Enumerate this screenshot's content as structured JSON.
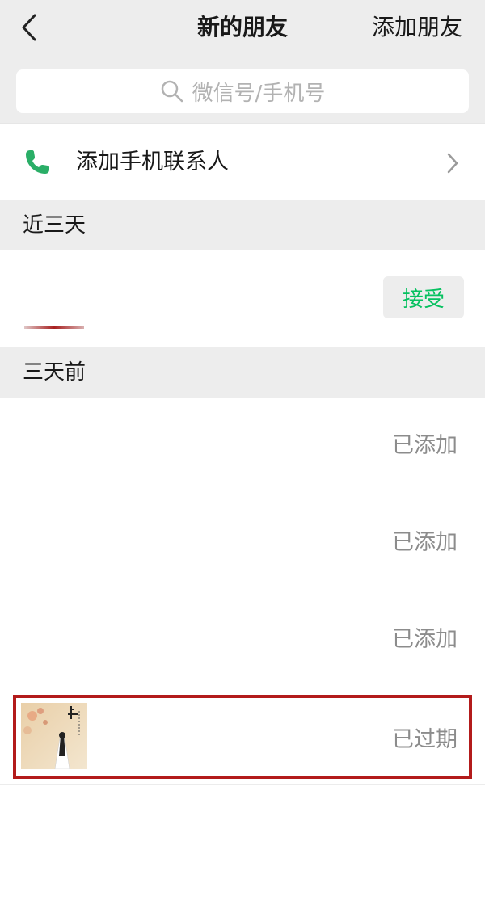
{
  "header": {
    "title": "新的朋友",
    "add_friend_label": "添加朋友",
    "search_placeholder": "微信号/手机号"
  },
  "phone_contacts": {
    "label": "添加手机联系人"
  },
  "sections": {
    "recent": "近三天",
    "earlier": "三天前"
  },
  "recent_requests": [
    {
      "status_label": "接受"
    }
  ],
  "earlier_requests": [
    {
      "status_label": "已添加"
    },
    {
      "status_label": "已添加"
    },
    {
      "status_label": "已添加"
    },
    {
      "status_label": "已过期"
    }
  ],
  "colors": {
    "accent_green": "#07c160",
    "highlight_red": "#b31b1b"
  },
  "icons": [
    "back-icon",
    "search-icon",
    "phone-icon",
    "chevron-right-icon"
  ]
}
